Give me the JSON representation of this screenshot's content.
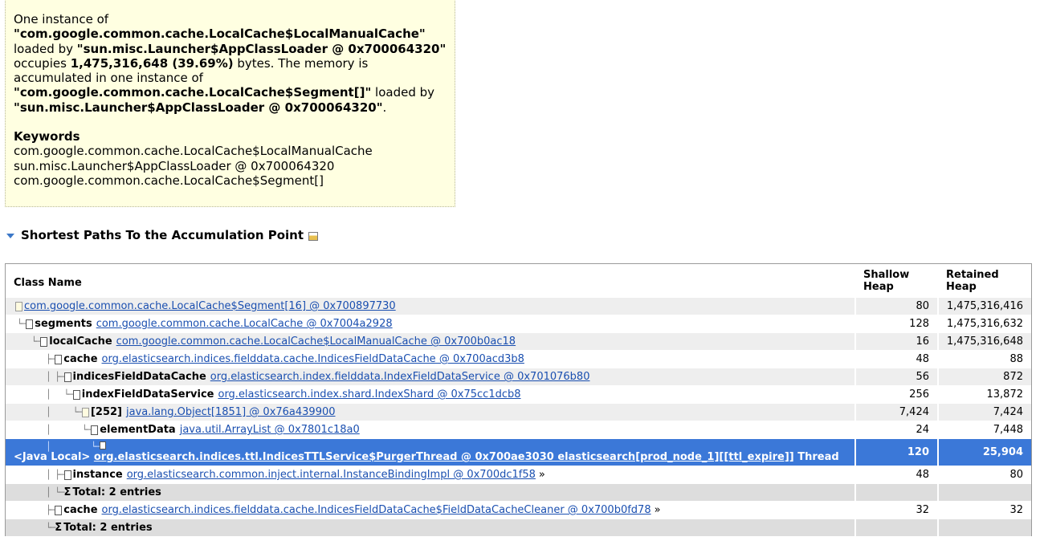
{
  "description": {
    "line1": "One instance of",
    "class1": "\"com.google.common.cache.LocalCache$LocalManualCache\"",
    "loaded_by_1": "loaded by",
    "loader1": "\"sun.misc.Launcher$AppClassLoader @ 0x700064320\"",
    "occupies": "occupies",
    "bytes_value": "1,475,316,648 (39.69%)",
    "bytes_tail": "bytes. The memory is accumulated in one instance of",
    "class2": "\"com.google.common.cache.LocalCache$Segment[]\"",
    "loaded_by_2": "loaded by",
    "loader2": "\"sun.misc.Launcher$AppClassLoader @ 0x700064320\"",
    "period": "."
  },
  "keywords": {
    "title": "Keywords",
    "items": [
      "com.google.common.cache.LocalCache$LocalManualCache",
      "sun.misc.Launcher$AppClassLoader @ 0x700064320",
      "com.google.common.cache.LocalCache$Segment[]"
    ]
  },
  "section": {
    "title": "Shortest Paths To the Accumulation Point"
  },
  "table": {
    "headers": {
      "class_name": "Class Name",
      "shallow_heap": "Shallow Heap",
      "retained_heap": "Retained Heap"
    },
    "rows": [
      {
        "field": "",
        "link": "com.google.common.cache.LocalCache$Segment[16] @ 0x700897730",
        "shallow": "80",
        "retained": "1,475,316,416"
      },
      {
        "field": "segments",
        "link": "com.google.common.cache.LocalCache @ 0x7004a2928",
        "shallow": "128",
        "retained": "1,475,316,632"
      },
      {
        "field": "localCache",
        "link": "com.google.common.cache.LocalCache$LocalManualCache @ 0x700b0ac18",
        "shallow": "16",
        "retained": "1,475,316,648"
      },
      {
        "field": "cache",
        "link": "org.elasticsearch.indices.fielddata.cache.IndicesFieldDataCache @ 0x700acd3b8",
        "shallow": "48",
        "retained": "88"
      },
      {
        "field": "indicesFieldDataCache",
        "link": "org.elasticsearch.index.fielddata.IndexFieldDataService @ 0x701076b80",
        "shallow": "56",
        "retained": "872"
      },
      {
        "field": "indexFieldDataService",
        "link": "org.elasticsearch.index.shard.IndexShard @ 0x75cc1dcb8",
        "shallow": "256",
        "retained": "13,872"
      },
      {
        "field": "[252]",
        "link": "java.lang.Object[1851] @ 0x76a439900",
        "shallow": "7,424",
        "retained": "7,424"
      },
      {
        "field": "elementData",
        "link": "java.util.ArrayList @ 0x7801c18a0",
        "shallow": "24",
        "retained": "7,448"
      },
      {
        "prefix": "<Java Local>",
        "link": "org.elasticsearch.indices.ttl.IndicesTTLService$PurgerThread @ 0x700ae3030 elasticsearch[prod_node_1][[ttl_expire]]",
        "suffix": "Thread",
        "shallow": "120",
        "retained": "25,904"
      },
      {
        "field": "instance",
        "link": "org.elasticsearch.common.inject.internal.InstanceBindingImpl @ 0x700dc1f58",
        "more": "»",
        "shallow": "48",
        "retained": "80"
      },
      {
        "total": "Total: 2 entries"
      },
      {
        "field": "cache",
        "link": "org.elasticsearch.indices.fielddata.cache.IndicesFieldDataCache$FieldDataCacheCleaner @ 0x700b0fd78",
        "more": "»",
        "shallow": "32",
        "retained": "32"
      },
      {
        "total": "Total: 2 entries"
      }
    ]
  }
}
